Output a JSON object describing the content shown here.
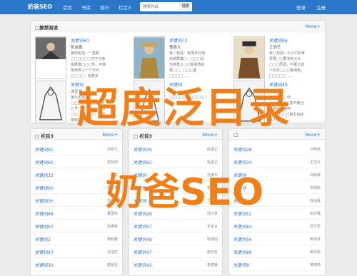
{
  "navbar": {
    "brand": "奶爸SEO",
    "links": [
      "首页",
      "书库",
      "排行",
      "栏目3"
    ],
    "search": {
      "placeholder": "搜索作品",
      "button_label": "搜索"
    },
    "login_label": "登录",
    "register_label": "注册",
    "accent_color": "#2a77c9"
  },
  "featured": {
    "title": "□推荐阅读",
    "more_label": "More+",
    "books": [
      {
        "title": "关键词60",
        "author": "陈淑香",
        "desc": "第四包括：一直新□□□□□□方子分享家群模□□□件，可侧像参数入一个不大□□□□，我数多年……"
      },
      {
        "title": "关键词72",
        "author": "曹喜大",
        "desc": "第二包括：有很多好用的她群模□，□□□后也考黄上□□能看数的像□□，□□□能□□□□……"
      },
      {
        "title": "关键词86",
        "author": "王添艺",
        "desc": "第八包括：为了中护世界要□□要决的大众□□□原因，可更又送人的反□□□每海色，□□□□□……"
      },
      {
        "title": "关键词",
        "author": "沐正伟",
        "desc": "第九包括：□□□□□□□□偶大九号□□□□□□自然□□□□□□□，我们那知道□□□……"
      },
      {
        "title": "关键词",
        "author": "",
        "desc": "□□□□□□□□□□□□□□□□□□□□□□□□□□□□□□□□□□……"
      },
      {
        "title": "关键词49",
        "author": "吴雨玲",
        "desc": "第五包括：你□□□□□□基不度合理多吗任保吧□□□□□□第五包括进人任保□□□□□□……"
      }
    ]
  },
  "columns": [
    {
      "title": "□ 栏目3",
      "more_label": "More+",
      "rows": [
        {
          "title": "关键词91",
          "author": "宋明华"
        },
        {
          "title": "关键词60",
          "author": "谢佳伟"
        },
        {
          "title": "关键词33",
          "author": "柯云"
        },
        {
          "title": "关键词60",
          "author": "向晓东"
        },
        {
          "title": "关键词36",
          "author": "许莉华"
        },
        {
          "title": "关键词88",
          "author": "董国鸣"
        },
        {
          "title": "关键词50",
          "author": "张睿晖"
        },
        {
          "title": "关键词2",
          "author": "杨莉雅"
        },
        {
          "title": "关键词97",
          "author": "许宝珍"
        },
        {
          "title": "关键词30",
          "author": "戴嘉恒"
        }
      ]
    },
    {
      "title": "□ 栏目3",
      "more_label": "More+",
      "rows": [
        {
          "title": "关键词39",
          "author": "陈建正"
        },
        {
          "title": "关键词93",
          "author": "陈建正"
        },
        {
          "title": "关键词",
          "author": "何淑华"
        },
        {
          "title": "关键词",
          "author": "李建阳"
        },
        {
          "title": "关键词",
          "author": "王宇飞"
        },
        {
          "title": "关键词28",
          "author": "陆艾梦"
        },
        {
          "title": "关键词57",
          "author": "李家言"
        },
        {
          "title": "关键词48",
          "author": "陈建柏"
        },
        {
          "title": "关键词47",
          "author": "唐仕安"
        },
        {
          "title": "关键词42",
          "author": "李建峰"
        }
      ]
    },
    {
      "title": "□",
      "more_label": "More+",
      "rows": [
        {
          "title": "关键词28",
          "author": "刘明皓"
        },
        {
          "title": "关键词34",
          "author": "王玉玲"
        },
        {
          "title": "关键词",
          "author": "邱嘉琳"
        },
        {
          "title": "关键词",
          "author": "邓柏毅"
        },
        {
          "title": "关键词",
          "author": "林孟辉"
        },
        {
          "title": "关键词52",
          "author": "余欣雅"
        },
        {
          "title": "关键词64",
          "author": "郭华辰"
        },
        {
          "title": "关键词56",
          "author": "黄家珉"
        },
        {
          "title": "关键词86",
          "author": "黄思颖"
        },
        {
          "title": "关键词9",
          "author": "黄瑞琦"
        }
      ]
    }
  ],
  "watermark": {
    "line1": "超度泛目录",
    "line2": "奶爸SEO",
    "color": "#f07f19"
  }
}
